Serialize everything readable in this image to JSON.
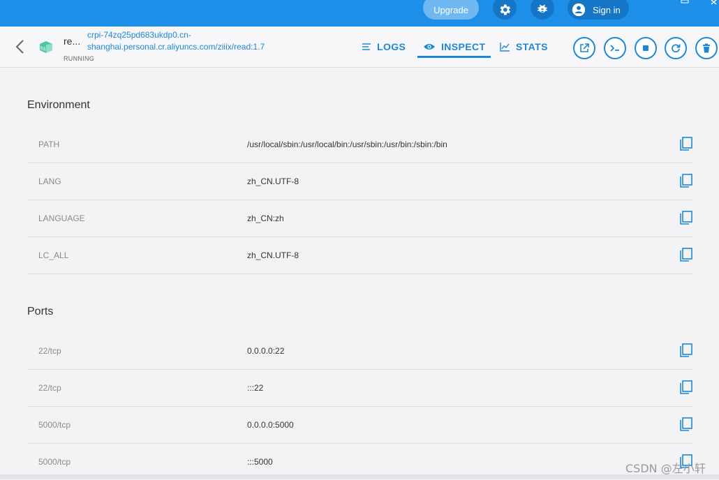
{
  "topbar": {
    "upgrade_label": "Upgrade",
    "signin_label": "Sign in",
    "accent": "#1e8fe8"
  },
  "header": {
    "container_name": "re...",
    "container_status": "RUNNING",
    "image_line1": "crpi-74zq25pd683ukdp0.cn-",
    "image_line2": "shanghai.personal.cr.aliyuncs.com/ziiix/read:1.7",
    "tabs": [
      {
        "label": "LOGS",
        "icon": "logs-icon"
      },
      {
        "label": "INSPECT",
        "icon": "eye-icon",
        "active": true
      },
      {
        "label": "STATS",
        "icon": "chart-icon"
      }
    ]
  },
  "environment": {
    "title": "Environment",
    "rows": [
      {
        "key": "PATH",
        "value": "/usr/local/sbin:/usr/local/bin:/usr/sbin:/usr/bin:/sbin:/bin"
      },
      {
        "key": "LANG",
        "value": "zh_CN.UTF-8"
      },
      {
        "key": "LANGUAGE",
        "value": "zh_CN:zh"
      },
      {
        "key": "LC_ALL",
        "value": "zh_CN.UTF-8"
      }
    ]
  },
  "ports": {
    "title": "Ports",
    "rows": [
      {
        "key": "22/tcp",
        "value": "0.0.0.0:22"
      },
      {
        "key": "22/tcp",
        "value": ":::22"
      },
      {
        "key": "5000/tcp",
        "value": "0.0.0.0:5000"
      },
      {
        "key": "5000/tcp",
        "value": ":::5000"
      }
    ]
  },
  "watermark": "CSDN @左小轩"
}
